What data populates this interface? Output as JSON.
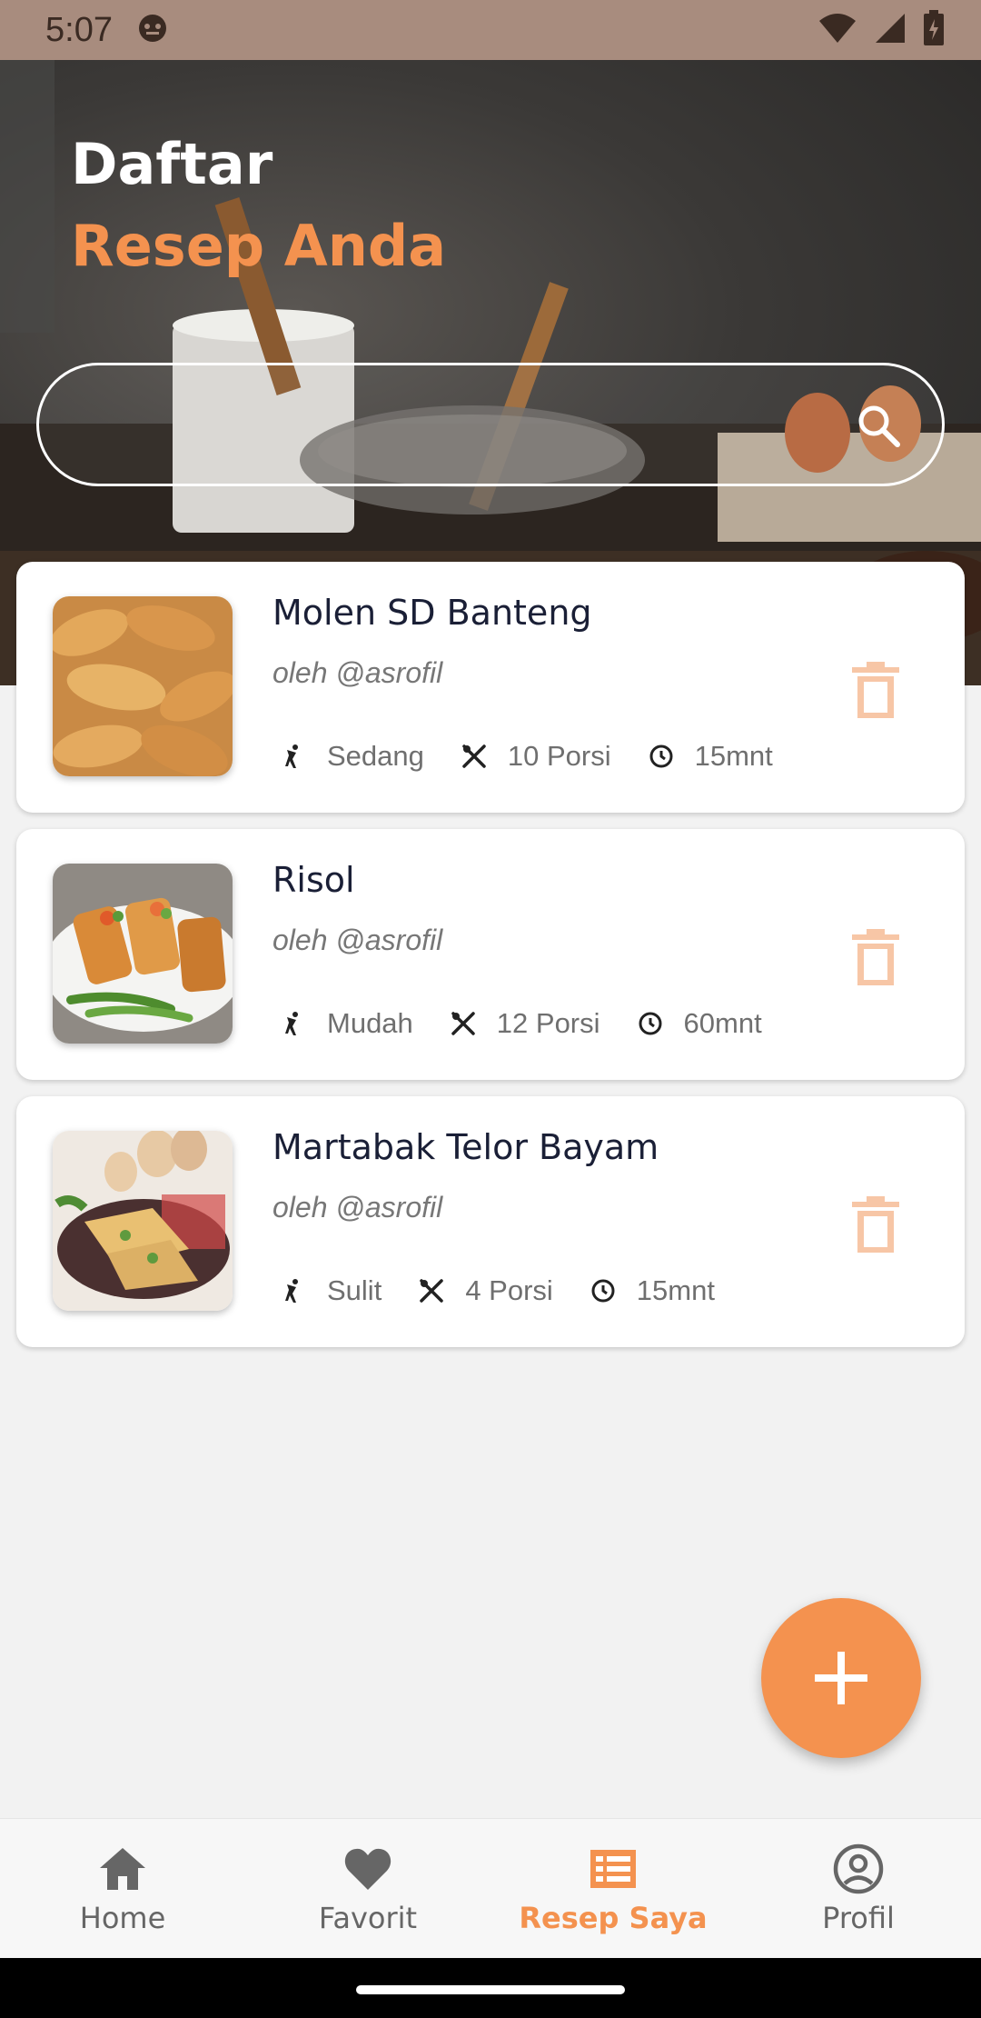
{
  "status_bar": {
    "time": "5:07"
  },
  "header": {
    "title_line1": "Daftar",
    "title_line2": "Resep Anda"
  },
  "search": {
    "placeholder": ""
  },
  "recipes": [
    {
      "title": "Molen SD Banteng",
      "author": "oleh @asrofil",
      "difficulty": "Sedang",
      "portions": "10 Porsi",
      "time": "15mnt"
    },
    {
      "title": "Risol",
      "author": "oleh @asrofil",
      "difficulty": "Mudah",
      "portions": "12 Porsi",
      "time": "60mnt"
    },
    {
      "title": "Martabak Telor Bayam",
      "author": "oleh @asrofil",
      "difficulty": "Sulit",
      "portions": "4 Porsi",
      "time": "15mnt"
    }
  ],
  "bottom_nav": {
    "items": [
      {
        "label": "Home",
        "icon": "home-icon"
      },
      {
        "label": "Favorit",
        "icon": "heart-icon"
      },
      {
        "label": "Resep Saya",
        "icon": "list-icon",
        "active": true
      },
      {
        "label": "Profil",
        "icon": "profile-icon"
      }
    ]
  },
  "colors": {
    "accent": "#f4924f",
    "title_dark": "#1a1f36"
  }
}
